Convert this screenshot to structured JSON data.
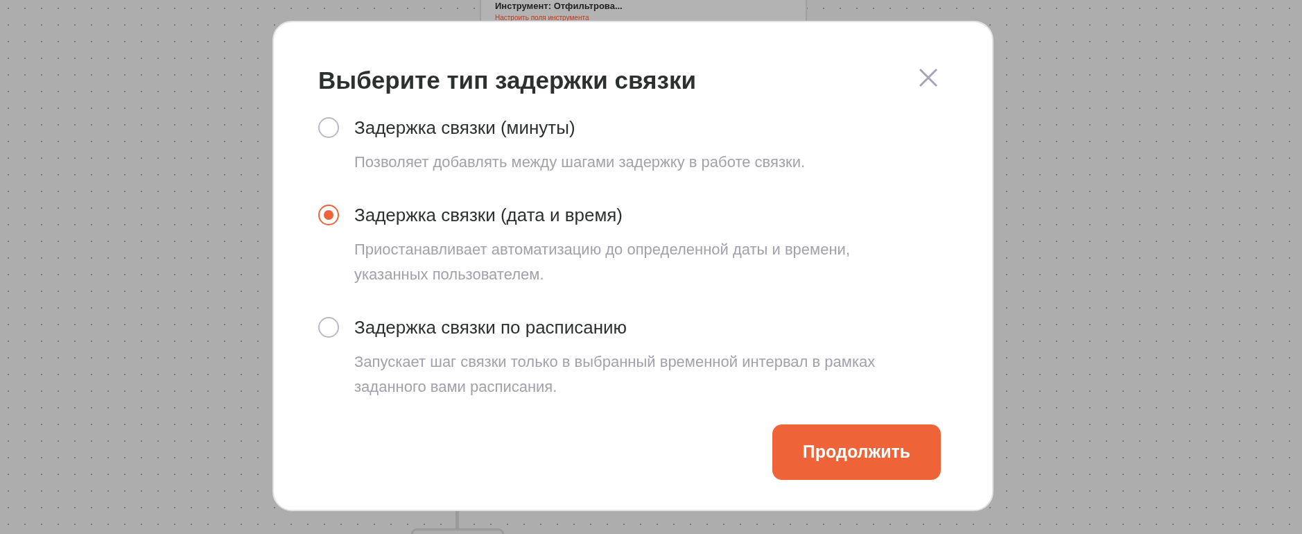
{
  "background_card": {
    "title": "Инструмент: Отфильтрова...",
    "link": "Настроить поля инструмента"
  },
  "dialog": {
    "title": "Выберите тип задержки связки",
    "options": [
      {
        "label": "Задержка связки (минуты)",
        "description": "Позволяет добавлять между шагами задержку в работе связки.",
        "selected": false
      },
      {
        "label": "Задержка связки (дата и время)",
        "description": "Приостанавливает автоматизацию до определенной даты и времени, указанных пользователем.",
        "selected": true
      },
      {
        "label": "Задержка связки по расписанию",
        "description": "Запускает шаг связки только в выбранный временной интервал в рамках заданного вами расписания.",
        "selected": false
      }
    ],
    "button": "Продолжить"
  }
}
